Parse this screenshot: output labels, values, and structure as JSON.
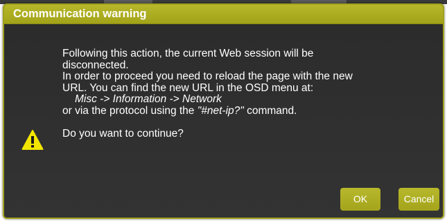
{
  "dialog": {
    "title": "Communication warning",
    "message": {
      "line1": "Following this action, the current Web session will be",
      "line2": "disconnected.",
      "line3": "In order to proceed you need to reload the page with the new",
      "line4": "URL. You can find the new URL in the OSD menu at:",
      "line5_path": "Misc -> Information -> Network",
      "line6_prefix": "or via the protocol using the ",
      "line6_command": "\"#net-ip?\"",
      "line6_suffix": " command.",
      "question": "Do you want to continue?"
    },
    "buttons": {
      "ok_label": "OK",
      "cancel_label": "Cancel"
    },
    "icon": "warning-icon"
  },
  "colors": {
    "accent": "#a8a820",
    "dialog_bg": "#2f2f2f",
    "text": "#ffffff",
    "warning_yellow": "#f2e600"
  }
}
